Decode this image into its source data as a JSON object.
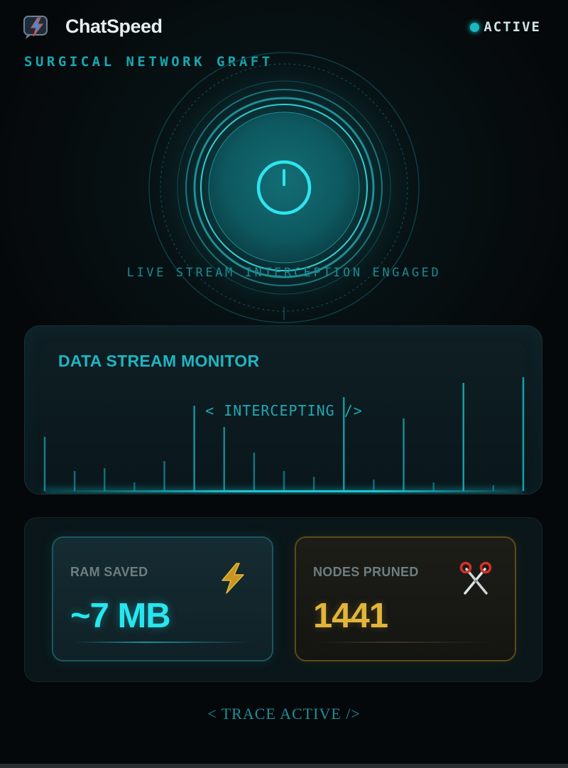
{
  "header": {
    "app_title": "ChatSpeed",
    "status_label": "ACTIVE",
    "subtitle": "SURGICAL NETWORK GRAFT"
  },
  "hero": {
    "power_icon": "power-icon",
    "engaged_text": "LIVE STREAM INTERCEPTION ENGAGED"
  },
  "monitor": {
    "title": "DATA STREAM MONITOR",
    "status_text": "< INTERCEPTING />",
    "stream_levels": [
      0.38,
      0.14,
      0.16,
      0.06,
      0.21,
      0.6,
      0.45,
      0.27,
      0.14,
      0.1,
      0.66,
      0.08,
      0.51,
      0.06,
      0.76,
      0.04,
      0.8
    ]
  },
  "stats": {
    "ram": {
      "label": "RAM SAVED",
      "value": "~7 MB",
      "icon": "lightning-bolt-icon"
    },
    "nodes": {
      "label": "NODES PRUNED",
      "value": "1441",
      "icon": "scissors-icon"
    }
  },
  "footer": {
    "trace_text": "< TRACE ACTIVE />"
  },
  "colors": {
    "accent": "#1fd3dc",
    "gold": "#e2b53a",
    "background": "#05080a"
  }
}
